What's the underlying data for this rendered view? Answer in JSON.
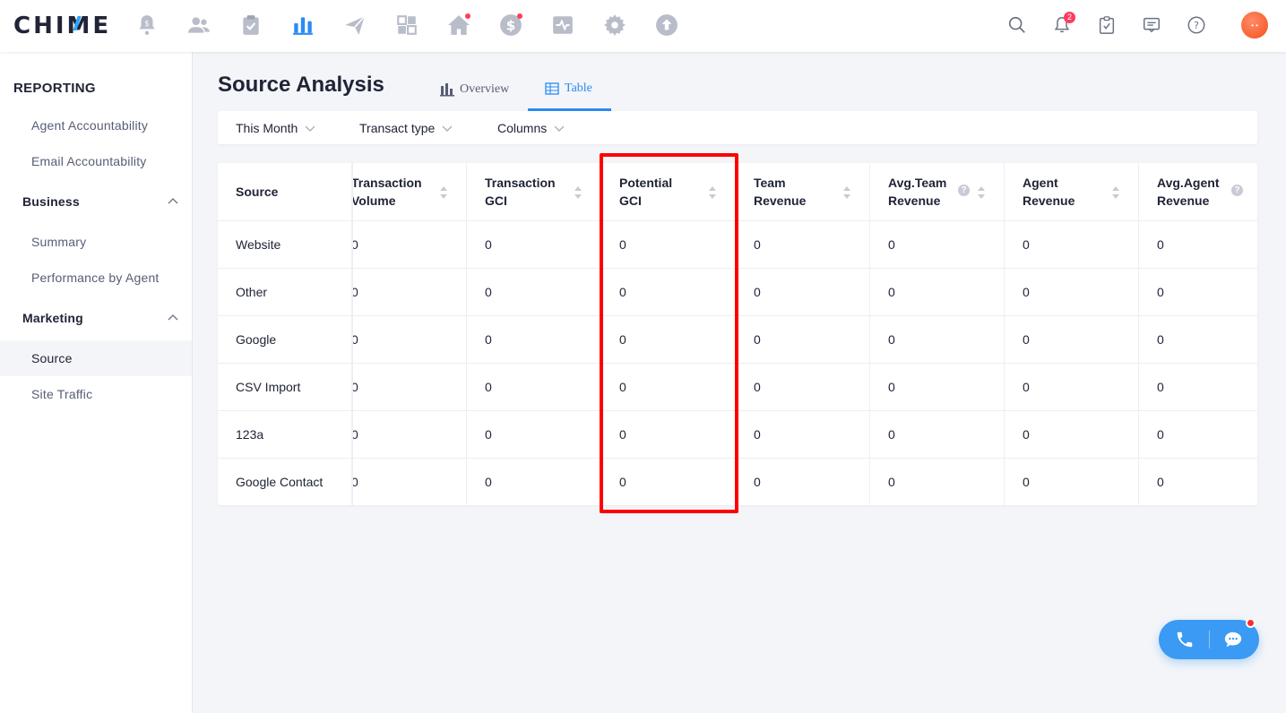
{
  "app": {
    "logo": "CHIME"
  },
  "topnav": {
    "icons": [
      "dollar-bell-icon",
      "people-icon",
      "clipboard-check-icon",
      "bar-chart-icon",
      "paper-plane-icon",
      "grid-icon",
      "house-icon",
      "dollar-circle-icon",
      "pulse-icon",
      "gear-icon",
      "upload-circle-icon"
    ],
    "active": "bar-chart-icon",
    "right": {
      "search": "search-icon",
      "notifications": "bell-icon",
      "notification_count": "2",
      "tasks": "task-check-icon",
      "messages": "message-icon",
      "help": "help-icon",
      "avatar_text": "• •"
    }
  },
  "sidebar": {
    "title": "REPORTING",
    "items_top": [
      "Agent Accountability",
      "Email Accountability"
    ],
    "business": {
      "label": "Business",
      "items": [
        "Summary",
        "Performance by Agent"
      ]
    },
    "marketing": {
      "label": "Marketing",
      "items": [
        "Source",
        "Site Traffic"
      ]
    },
    "active": "Source"
  },
  "main": {
    "title": "Source Analysis",
    "tabs": [
      {
        "label": "Overview",
        "icon": "bar-chart-icon",
        "active": false
      },
      {
        "label": "Table",
        "icon": "table-icon",
        "active": true
      }
    ],
    "filters": [
      "This Month",
      "Transact type",
      "Columns"
    ]
  },
  "table": {
    "source_header": "Source",
    "columns": [
      {
        "label_1": "Transaction",
        "label_2": "Volume",
        "help": false
      },
      {
        "label_1": "Transaction",
        "label_2": "GCI",
        "help": false
      },
      {
        "label_1": "Potential",
        "label_2": "GCI",
        "help": false
      },
      {
        "label_1": "Team",
        "label_2": "Revenue",
        "help": false
      },
      {
        "label_1": "Avg.Team",
        "label_2": "Revenue",
        "help": true
      },
      {
        "label_1": "Agent",
        "label_2": "Revenue",
        "help": false
      },
      {
        "label_1": "Avg.Agent",
        "label_2": "Revenue",
        "help": true
      }
    ],
    "rows": [
      {
        "source": "Website",
        "values": [
          "0",
          "0",
          "0",
          "0",
          "0",
          "0",
          "0"
        ]
      },
      {
        "source": "Other",
        "values": [
          "0",
          "0",
          "0",
          "0",
          "0",
          "0",
          "0"
        ]
      },
      {
        "source": "Google",
        "values": [
          "0",
          "0",
          "0",
          "0",
          "0",
          "0",
          "0"
        ]
      },
      {
        "source": "CSV Import",
        "values": [
          "0",
          "0",
          "0",
          "0",
          "0",
          "0",
          "0"
        ]
      },
      {
        "source": "123a",
        "values": [
          "0",
          "0",
          "0",
          "0",
          "0",
          "0",
          "0"
        ]
      },
      {
        "source": "Google Contact",
        "values": [
          "0",
          "0",
          "0",
          "0",
          "0",
          "0",
          "0"
        ]
      }
    ],
    "highlighted_column": "Potential GCI"
  },
  "floating": {
    "phone": "phone-icon",
    "chat": "chat-bubble-icon"
  },
  "colors": {
    "accent": "#2a8bf2",
    "highlight": "#ff0000",
    "badge": "#ff3b5c"
  }
}
